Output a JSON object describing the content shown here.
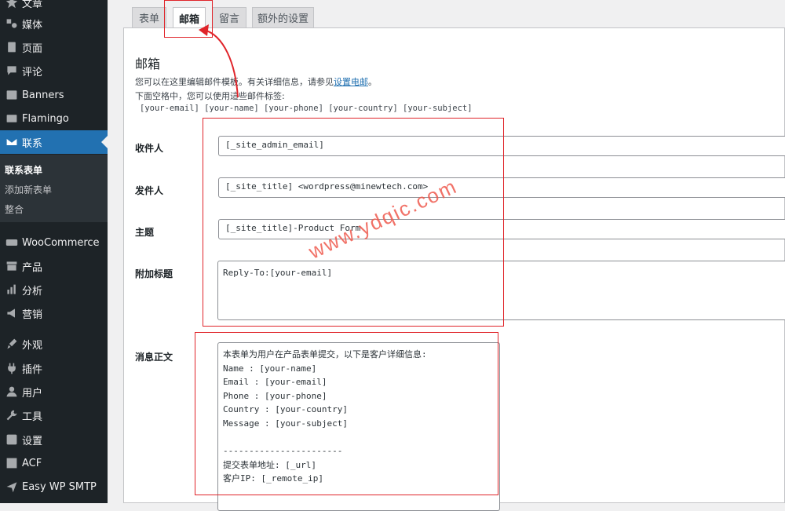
{
  "sidebar": {
    "items": [
      {
        "label": "文章",
        "icon": "pin-icon"
      },
      {
        "label": "媒体",
        "icon": "media-icon"
      },
      {
        "label": "页面",
        "icon": "page-icon"
      },
      {
        "label": "评论",
        "icon": "comment-icon"
      },
      {
        "label": "Banners",
        "icon": "banner-icon"
      },
      {
        "label": "Flamingo",
        "icon": "flamingo-icon"
      },
      {
        "label": "联系",
        "icon": "mail-icon"
      },
      {
        "label": "WooCommerce",
        "icon": "woo-icon"
      },
      {
        "label": "产品",
        "icon": "archive-icon"
      },
      {
        "label": "分析",
        "icon": "chart-icon"
      },
      {
        "label": "营销",
        "icon": "megaphone-icon"
      },
      {
        "label": "外观",
        "icon": "brush-icon"
      },
      {
        "label": "插件",
        "icon": "plugin-icon"
      },
      {
        "label": "用户",
        "icon": "user-icon"
      },
      {
        "label": "工具",
        "icon": "wrench-icon"
      },
      {
        "label": "设置",
        "icon": "settings-icon"
      },
      {
        "label": "ACF",
        "icon": "acf-icon"
      },
      {
        "label": "Easy WP SMTP",
        "icon": "smtp-icon"
      }
    ],
    "submenu": [
      "联系表单",
      "添加新表单",
      "整合"
    ]
  },
  "tabs": [
    "表单",
    "邮箱",
    "留言",
    "额外的设置"
  ],
  "mail": {
    "title": "邮箱",
    "desc1": "您可以在这里编辑邮件模板。有关详细信息，请参见",
    "desc1_link": "设置电邮",
    "desc1_end": "。",
    "desc2": "下面空格中，您可以使用這些邮件标签:",
    "tags": "[your-email] [your-name] [your-phone] [your-country] [your-subject]",
    "to_label": "收件人",
    "to_value": "[_site_admin_email]",
    "from_label": "发件人",
    "from_value": "[_site_title] <wordpress@minewtech.com>",
    "subject_label": "主题",
    "subject_value": "[_site_title]-Product Form",
    "headers_label": "附加标题",
    "headers_value": "Reply-To:[your-email]",
    "body_label": "消息正文",
    "body_value": "本表单为用户在产品表单提交，以下是客户详细信息:\nName : [your-name]\nEmail : [your-email]\nPhone : [your-phone]\nCountry : [your-country]\nMessage : [your-subject]\n\n-----------------------\n提交表单地址: [_url]\n客户IP: [_remote_ip]"
  },
  "watermark": "www.ydqic.com",
  "colors": {
    "sidebar_bg": "#1d2327",
    "accent": "#2271b1",
    "annotation": "#e0242a"
  }
}
